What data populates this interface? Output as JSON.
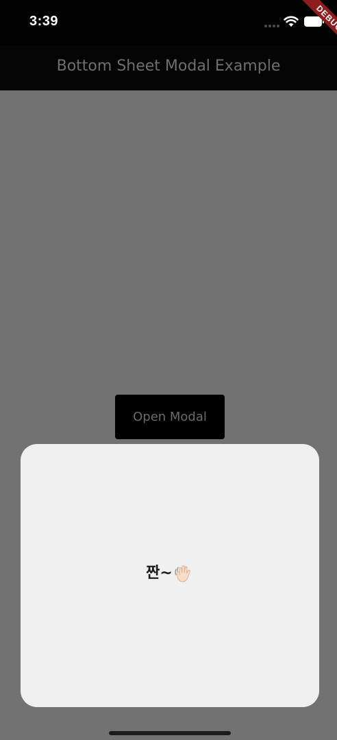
{
  "status_bar": {
    "time": "3:39",
    "icons": [
      "signal-icon",
      "wifi-icon",
      "battery-icon"
    ]
  },
  "debug_banner": {
    "label": "DEBUG",
    "color": "#8f1d1d"
  },
  "app_bar": {
    "title": "Bottom Sheet Modal Example"
  },
  "main": {
    "open_modal_label": "Open Modal"
  },
  "bottom_sheet": {
    "message": "짠~",
    "icon": "waving-hand-icon"
  },
  "colors": {
    "scrim": "#727272",
    "app_bar": "#050505",
    "sheet": "#f0f0f0",
    "button": "#000000"
  }
}
